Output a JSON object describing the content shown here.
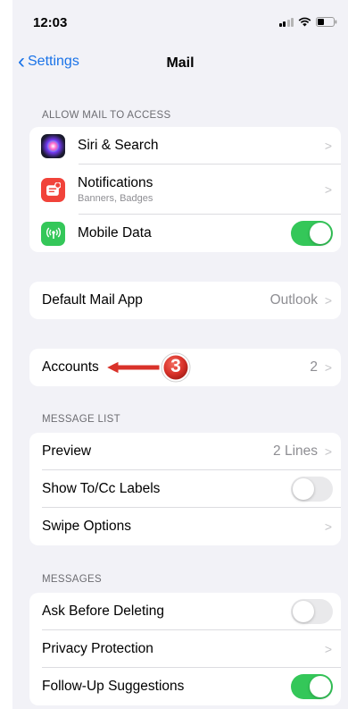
{
  "status_bar": {
    "time": "12:03"
  },
  "nav": {
    "back_label": "Settings",
    "title": "Mail"
  },
  "allow_section": {
    "header": "ALLOW MAIL TO ACCESS",
    "siri": {
      "label": "Siri & Search",
      "icon": "siri-icon"
    },
    "notifications": {
      "label": "Notifications",
      "sublabel": "Banners, Badges",
      "icon": "notifications-icon"
    },
    "mobile_data": {
      "label": "Mobile Data",
      "icon": "antenna-icon",
      "toggle_on": true
    }
  },
  "default_app": {
    "label": "Default Mail App",
    "value": "Outlook"
  },
  "accounts": {
    "label": "Accounts",
    "value": "2"
  },
  "annotation": {
    "number": "3",
    "color": "#d9322a"
  },
  "message_list": {
    "header": "MESSAGE LIST",
    "preview": {
      "label": "Preview",
      "value": "2 Lines"
    },
    "show_tocc": {
      "label": "Show To/Cc Labels",
      "toggle_on": false
    },
    "swipe": {
      "label": "Swipe Options"
    }
  },
  "messages": {
    "header": "MESSAGES",
    "ask_before_deleting": {
      "label": "Ask Before Deleting",
      "toggle_on": false
    },
    "privacy_protection": {
      "label": "Privacy Protection"
    },
    "follow_up": {
      "label": "Follow-Up Suggestions",
      "toggle_on": true
    }
  },
  "colors": {
    "accent": "#1a73e8",
    "toggle_on": "#34c759",
    "background": "#f2f2f7"
  }
}
